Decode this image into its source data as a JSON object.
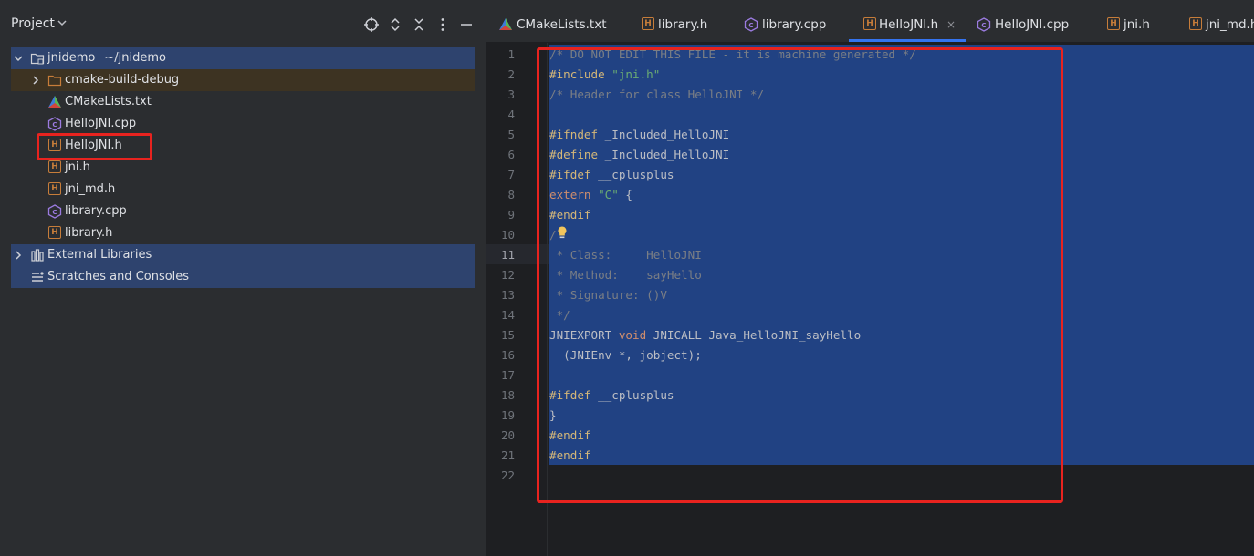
{
  "project_panel": {
    "title": "Project",
    "tree": [
      {
        "label": "jnidemo",
        "path": "~/jnidemo",
        "icon": "folder-icon"
      },
      {
        "label": "cmake-build-debug",
        "icon": "folder-icon"
      },
      {
        "label": "CMakeLists.txt",
        "icon": "cmake-icon"
      },
      {
        "label": "HelloJNI.cpp",
        "icon": "cpp-file-icon"
      },
      {
        "label": "HelloJNI.h",
        "icon": "header-file-icon"
      },
      {
        "label": "jni.h",
        "icon": "header-file-icon"
      },
      {
        "label": "jni_md.h",
        "icon": "header-file-icon"
      },
      {
        "label": "library.cpp",
        "icon": "cpp-file-icon"
      },
      {
        "label": "library.h",
        "icon": "header-file-icon"
      },
      {
        "label": "External Libraries",
        "icon": "library-icon"
      },
      {
        "label": "Scratches and Consoles",
        "icon": "scratches-icon"
      }
    ]
  },
  "tabs": [
    {
      "label": "CMakeLists.txt",
      "icon": "cmake-icon"
    },
    {
      "label": "library.h",
      "icon": "header-file-icon"
    },
    {
      "label": "library.cpp",
      "icon": "cpp-file-icon"
    },
    {
      "label": "HelloJNI.h",
      "icon": "header-file-icon",
      "active": true,
      "close": "×"
    },
    {
      "label": "HelloJNI.cpp",
      "icon": "cpp-file-icon"
    },
    {
      "label": "jni.h",
      "icon": "header-file-icon"
    },
    {
      "label": "jni_md.h",
      "icon": "header-file-icon"
    }
  ],
  "editor": {
    "current_line": 11,
    "line_numbers": [
      "1",
      "2",
      "3",
      "4",
      "5",
      "6",
      "7",
      "8",
      "9",
      "10",
      "11",
      "12",
      "13",
      "14",
      "15",
      "16",
      "17",
      "18",
      "19",
      "20",
      "21",
      "22"
    ],
    "lines": [
      [
        {
          "t": "/* DO NOT EDIT THIS FILE - it is machine generated */",
          "c": "comment"
        }
      ],
      [
        {
          "t": "#include ",
          "c": "kw"
        },
        {
          "t": "\"jni.h\"",
          "c": "str"
        }
      ],
      [
        {
          "t": "/* Header for class HelloJNI */",
          "c": "comment"
        }
      ],
      [],
      [
        {
          "t": "#ifndef ",
          "c": "kw"
        },
        {
          "t": "_Included_HelloJNI",
          "c": ""
        }
      ],
      [
        {
          "t": "#define ",
          "c": "kw"
        },
        {
          "t": "_Included_HelloJNI",
          "c": ""
        }
      ],
      [
        {
          "t": "#ifdef ",
          "c": "kw"
        },
        {
          "t": "__cplusplus",
          "c": ""
        }
      ],
      [
        {
          "t": "extern ",
          "c": "kw2"
        },
        {
          "t": "\"C\"",
          "c": "str"
        },
        {
          "t": " {",
          "c": ""
        }
      ],
      [
        {
          "t": "#endif",
          "c": "kw"
        }
      ],
      [
        {
          "t": "/",
          "c": "comment"
        }
      ],
      [
        {
          "t": " * Class:     HelloJNI",
          "c": "comment"
        }
      ],
      [
        {
          "t": " * Method:    sayHello",
          "c": "comment"
        }
      ],
      [
        {
          "t": " * Signature: ()V",
          "c": "comment"
        }
      ],
      [
        {
          "t": " */",
          "c": "comment"
        }
      ],
      [
        {
          "t": "JNIEXPORT ",
          "c": ""
        },
        {
          "t": "void ",
          "c": "kw2"
        },
        {
          "t": "JNICALL Java_HelloJNI_sayHello",
          "c": ""
        }
      ],
      [
        {
          "t": "  (JNIEnv *, jobject);",
          "c": ""
        }
      ],
      [],
      [
        {
          "t": "#ifdef ",
          "c": "kw"
        },
        {
          "t": "__cplusplus",
          "c": ""
        }
      ],
      [
        {
          "t": "}",
          "c": ""
        }
      ],
      [
        {
          "t": "#endif",
          "c": "kw"
        }
      ],
      [
        {
          "t": "#endif",
          "c": "kw"
        }
      ],
      []
    ]
  },
  "colors": {
    "accent": "#3574f0",
    "selection": "#214283",
    "annotation": "#e8231f"
  }
}
